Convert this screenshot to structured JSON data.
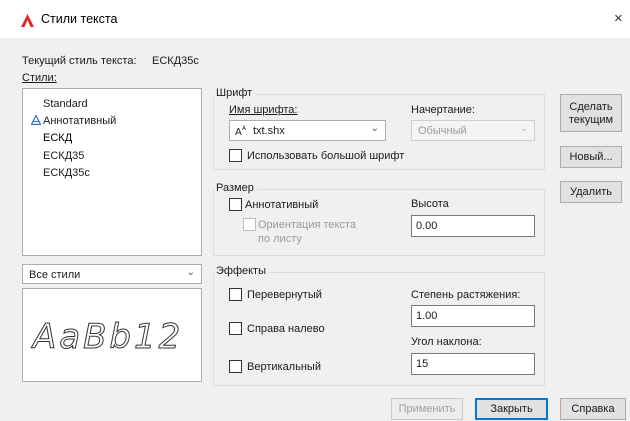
{
  "window": {
    "title": "Стили текста",
    "close_glyph": "×",
    "icon": "autocad-logo-icon",
    "accent_color": "#e3262b"
  },
  "current_style": {
    "label": "Текущий стиль текста:",
    "value": "ЕСКД35с"
  },
  "styles": {
    "label": "Стили:",
    "items": [
      "Standard",
      "Аннотативный",
      "ЕСКД",
      "ЕСКД35",
      "ЕСКД35с"
    ],
    "selected": "ЕСКД",
    "annotative_icon": "annotative-icon"
  },
  "filter": {
    "value": "Все стили"
  },
  "preview": {
    "text": "AaBb12"
  },
  "font": {
    "group_label": "Шрифт",
    "name_label": "Имя шрифта:",
    "name_value": "txt.shx",
    "font_file_icon": "shx-font-icon",
    "style_label": "Начертание:",
    "style_value": "Обычный",
    "bigfont_label": "Использовать большой шрифт"
  },
  "size": {
    "group_label": "Размер",
    "annotative_label": "Аннотативный",
    "orientation_label_line1": "Ориентация текста",
    "orientation_label_line2": "по листу",
    "height_label": "Высота",
    "height_value": "0.00"
  },
  "effects": {
    "group_label": "Эффекты",
    "upside_down_label": "Перевернутый",
    "backwards_label": "Справа налево",
    "vertical_label": "Вертикальный",
    "width_factor_label": "Степень растяжения:",
    "width_factor_value": "1.00",
    "oblique_label": "Угол наклона:",
    "oblique_value": "15"
  },
  "buttons": {
    "set_current_line1": "Сделать",
    "set_current_line2": "текущим",
    "new": "Новый...",
    "delete": "Удалить",
    "apply": "Применить",
    "close": "Закрыть",
    "help": "Справка"
  }
}
